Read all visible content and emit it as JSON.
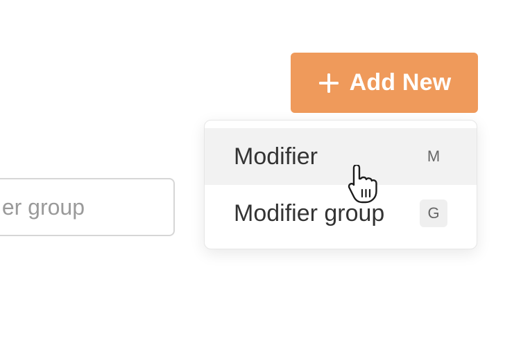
{
  "search": {
    "visible_text": "er group"
  },
  "add_button": {
    "label": "Add New",
    "icon": "plus-icon"
  },
  "dropdown": {
    "items": [
      {
        "label": "Modifier",
        "shortcut": "M",
        "highlighted": true
      },
      {
        "label": "Modifier group",
        "shortcut": "G",
        "highlighted": false
      }
    ]
  },
  "colors": {
    "accent": "#ef9a5b",
    "hover_bg": "#f2f2f2",
    "text": "#333333"
  }
}
